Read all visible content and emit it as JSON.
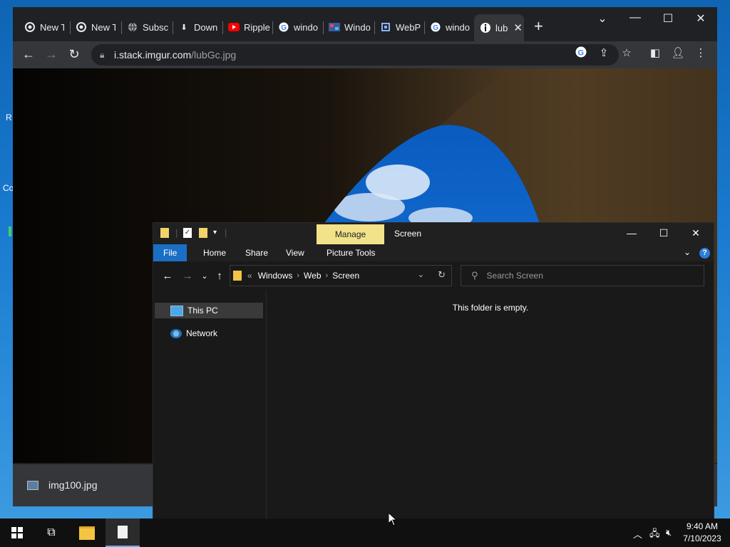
{
  "desktop": {
    "labels": [
      "R",
      "Co"
    ]
  },
  "chrome": {
    "tabs": [
      {
        "label": "New T",
        "icon": "chrome-icon"
      },
      {
        "label": "New T",
        "icon": "chrome-icon"
      },
      {
        "label": "Subsc",
        "icon": "globe-icon"
      },
      {
        "label": "Down",
        "icon": "download-icon"
      },
      {
        "label": "Ripple",
        "icon": "youtube-icon"
      },
      {
        "label": "windo",
        "icon": "google-icon"
      },
      {
        "label": "Windo",
        "icon": "site-icon"
      },
      {
        "label": "WebP",
        "icon": "site-icon"
      },
      {
        "label": "windo",
        "icon": "google-icon"
      },
      {
        "label": "lub",
        "icon": "imgur-icon"
      }
    ],
    "new_tab": "+",
    "url_host": "i.stack.imgur.com",
    "url_path": "/lubGc.jpg",
    "download_item": "img100.jpg"
  },
  "explorer": {
    "manage_label": "Manage",
    "title": "Screen",
    "ribbon_tabs": [
      "File",
      "Home",
      "Share",
      "View",
      "Picture Tools"
    ],
    "help": "?",
    "address": {
      "overflow": "«",
      "crumbs": [
        "Windows",
        "Web",
        "Screen"
      ]
    },
    "search_placeholder": "Search Screen",
    "nav_items": [
      "This PC",
      "Network"
    ],
    "empty_message": "This folder is empty."
  },
  "taskbar": {
    "time": "9:40 AM",
    "date": "7/10/2023"
  },
  "colors": {
    "desktop_blue": "#1a7bd0",
    "chrome_dark": "#202124",
    "manage_yellow": "#f2e28a",
    "file_tab_blue": "#1a6fc4"
  }
}
